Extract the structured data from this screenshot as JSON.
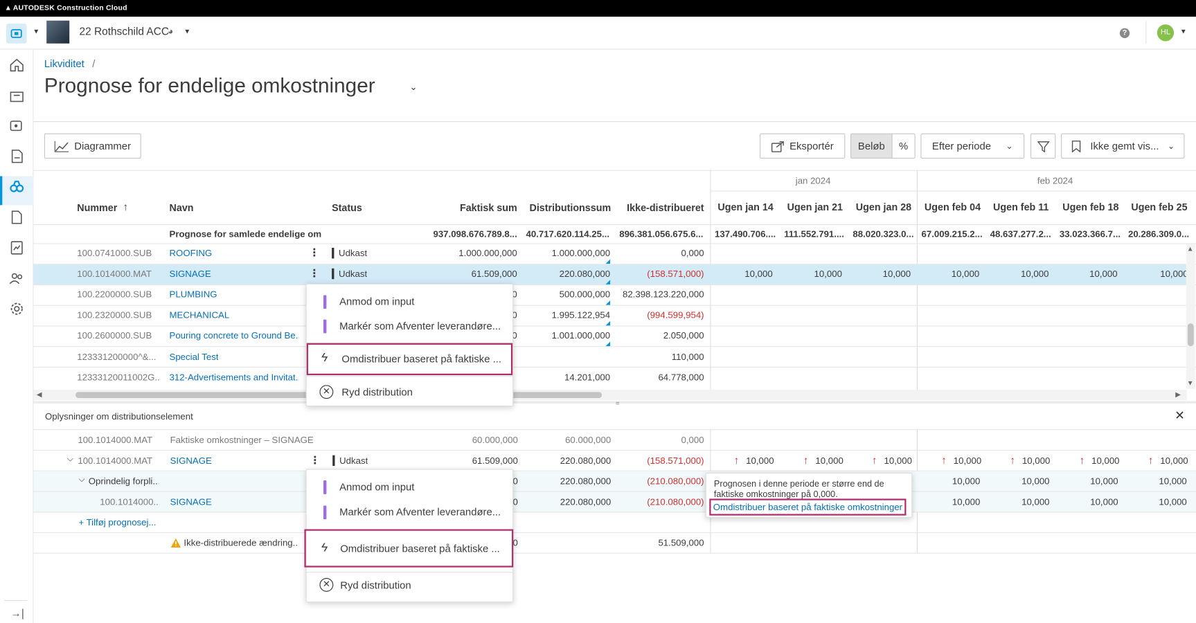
{
  "app": {
    "brand": "AUTODESK Construction Cloud",
    "project": "22 Rothschild ACC",
    "avatar": "HL"
  },
  "breadcrumb": {
    "parent": "Likviditet",
    "sep": "/"
  },
  "page": {
    "title": "Prognose for endelige omkostninger"
  },
  "toolbar": {
    "charts": "Diagrammer",
    "export": "Eksportér",
    "amount": "Beløb",
    "percent": "%",
    "period": "Efter periode",
    "view": "Ikke gemt vis..."
  },
  "months": [
    "jan 2024",
    "feb 2024"
  ],
  "columns": {
    "number": "Nummer",
    "name": "Navn",
    "status": "Status",
    "actual": "Faktisk sum",
    "distribution": "Distributionssum",
    "undistributed": "Ikke-distribueret",
    "weeks": [
      "Ugen jan 14",
      "Ugen jan 21",
      "Ugen jan 28",
      "Ugen feb 04",
      "Ugen feb 11",
      "Ugen feb 18",
      "Ugen feb 25"
    ]
  },
  "summary": {
    "name": "Prognose for samlede endelige omk...",
    "actual": "937.098.676.789.8...",
    "distribution": "40.717.620.114.25...",
    "undistributed": "896.381.056.675.6...",
    "weeks": [
      "137.490.706....",
      "111.552.791....",
      "88.020.323.0...",
      "67.009.215.2...",
      "48.637.277.2...",
      "33.023.366.7...",
      "20.286.309.0..."
    ]
  },
  "rows": [
    {
      "number": "100.0741000.SUB",
      "name": "ROOFING",
      "status": "Udkast",
      "actual": "1.000.000,000",
      "distribution": "1.000.000,000",
      "undistributed": "0,000",
      "weeks": []
    },
    {
      "number": "100.1014000.MAT",
      "name": "SIGNAGE",
      "status": "Udkast",
      "actual": "61.509,000",
      "distribution": "220.080,000",
      "undistributed": "(158.571,000)",
      "weeks": [
        "10,000",
        "10,000",
        "10,000",
        "10,000",
        "10,000",
        "10,000",
        "10,000"
      ]
    },
    {
      "number": "100.2200000.SUB",
      "name": "PLUMBING",
      "status": "",
      "actual": "0",
      "distribution": "500.000,000",
      "undistributed": "82.398.123.220,000",
      "weeks": []
    },
    {
      "number": "100.2320000.SUB",
      "name": "MECHANICAL",
      "status": "",
      "actual": "0",
      "distribution": "1.995.122,954",
      "undistributed": "(994.599,954)",
      "weeks": []
    },
    {
      "number": "100.2600000.SUB",
      "name": "Pouring concrete to Ground Be...",
      "status": "",
      "actual": "0",
      "distribution": "1.001.000,000",
      "undistributed": "2.050,000",
      "weeks": []
    },
    {
      "number": "123331200000^&...",
      "name": "Special Test",
      "status": "",
      "actual": "",
      "distribution": "",
      "undistributed": "110,000",
      "weeks": []
    },
    {
      "number": "12333120011002G...",
      "name": "312-Advertisements and Invitat...",
      "status": "",
      "actual": "",
      "distribution": "14.201,000",
      "undistributed": "64.778,000",
      "weeks": []
    }
  ],
  "menu": {
    "request": "Anmod om input",
    "mark": "Markér som Afventer leverandøre...",
    "redistribute": "Omdistribuer baseret på faktiske ...",
    "clear": "Ryd distribution"
  },
  "detail": {
    "title": "Oplysninger om distributionselement",
    "actual_row": {
      "number": "100.1014000.MAT",
      "name": "Faktiske omkostninger – SIGNAGE",
      "actual": "60.000,000",
      "distribution": "60.000,000",
      "undistributed": "0,000"
    },
    "item_row": {
      "number": "100.1014000.MAT",
      "name": "SIGNAGE",
      "status": "Udkast",
      "actual": "61.509,000",
      "distribution": "220.080,000",
      "undistributed": "(158.571,000)",
      "weeks": [
        "10,000",
        "10,000",
        "10,000",
        "10,000",
        "10,000",
        "10,000",
        "10,000"
      ]
    },
    "orig_row": {
      "label": "Oprindelig forpli...",
      "actual": "0",
      "distribution": "220.080,000",
      "undistributed": "(210.080,000)",
      "weeks": [
        "10,000",
        "10,000",
        "10,000",
        "10,000"
      ]
    },
    "sub_row": {
      "number": "100.1014000...",
      "name": "SIGNAGE",
      "actual": "0",
      "distribution": "220.080,000",
      "undistributed": "(210.080,000)",
      "weeks": [
        "10,000",
        "10,000",
        "10,000",
        "10,000"
      ]
    },
    "add": "+ Tilføj prognosej...",
    "undist": {
      "name": "Ikke-distribuerede ændring...",
      "actual": "0",
      "undistributed": "51.509,000"
    }
  },
  "tooltip": {
    "text": "Prognosen i denne periode er større end de faktiske omkostninger på 0,000.",
    "link": "Omdistribuer baseret på faktiske omkostninger"
  },
  "colors": {
    "accent": "#0696d7",
    "link": "#0670b8",
    "negative": "#d0302e",
    "highlight": "#b32a6c",
    "status_marker": "#a16ce8"
  }
}
